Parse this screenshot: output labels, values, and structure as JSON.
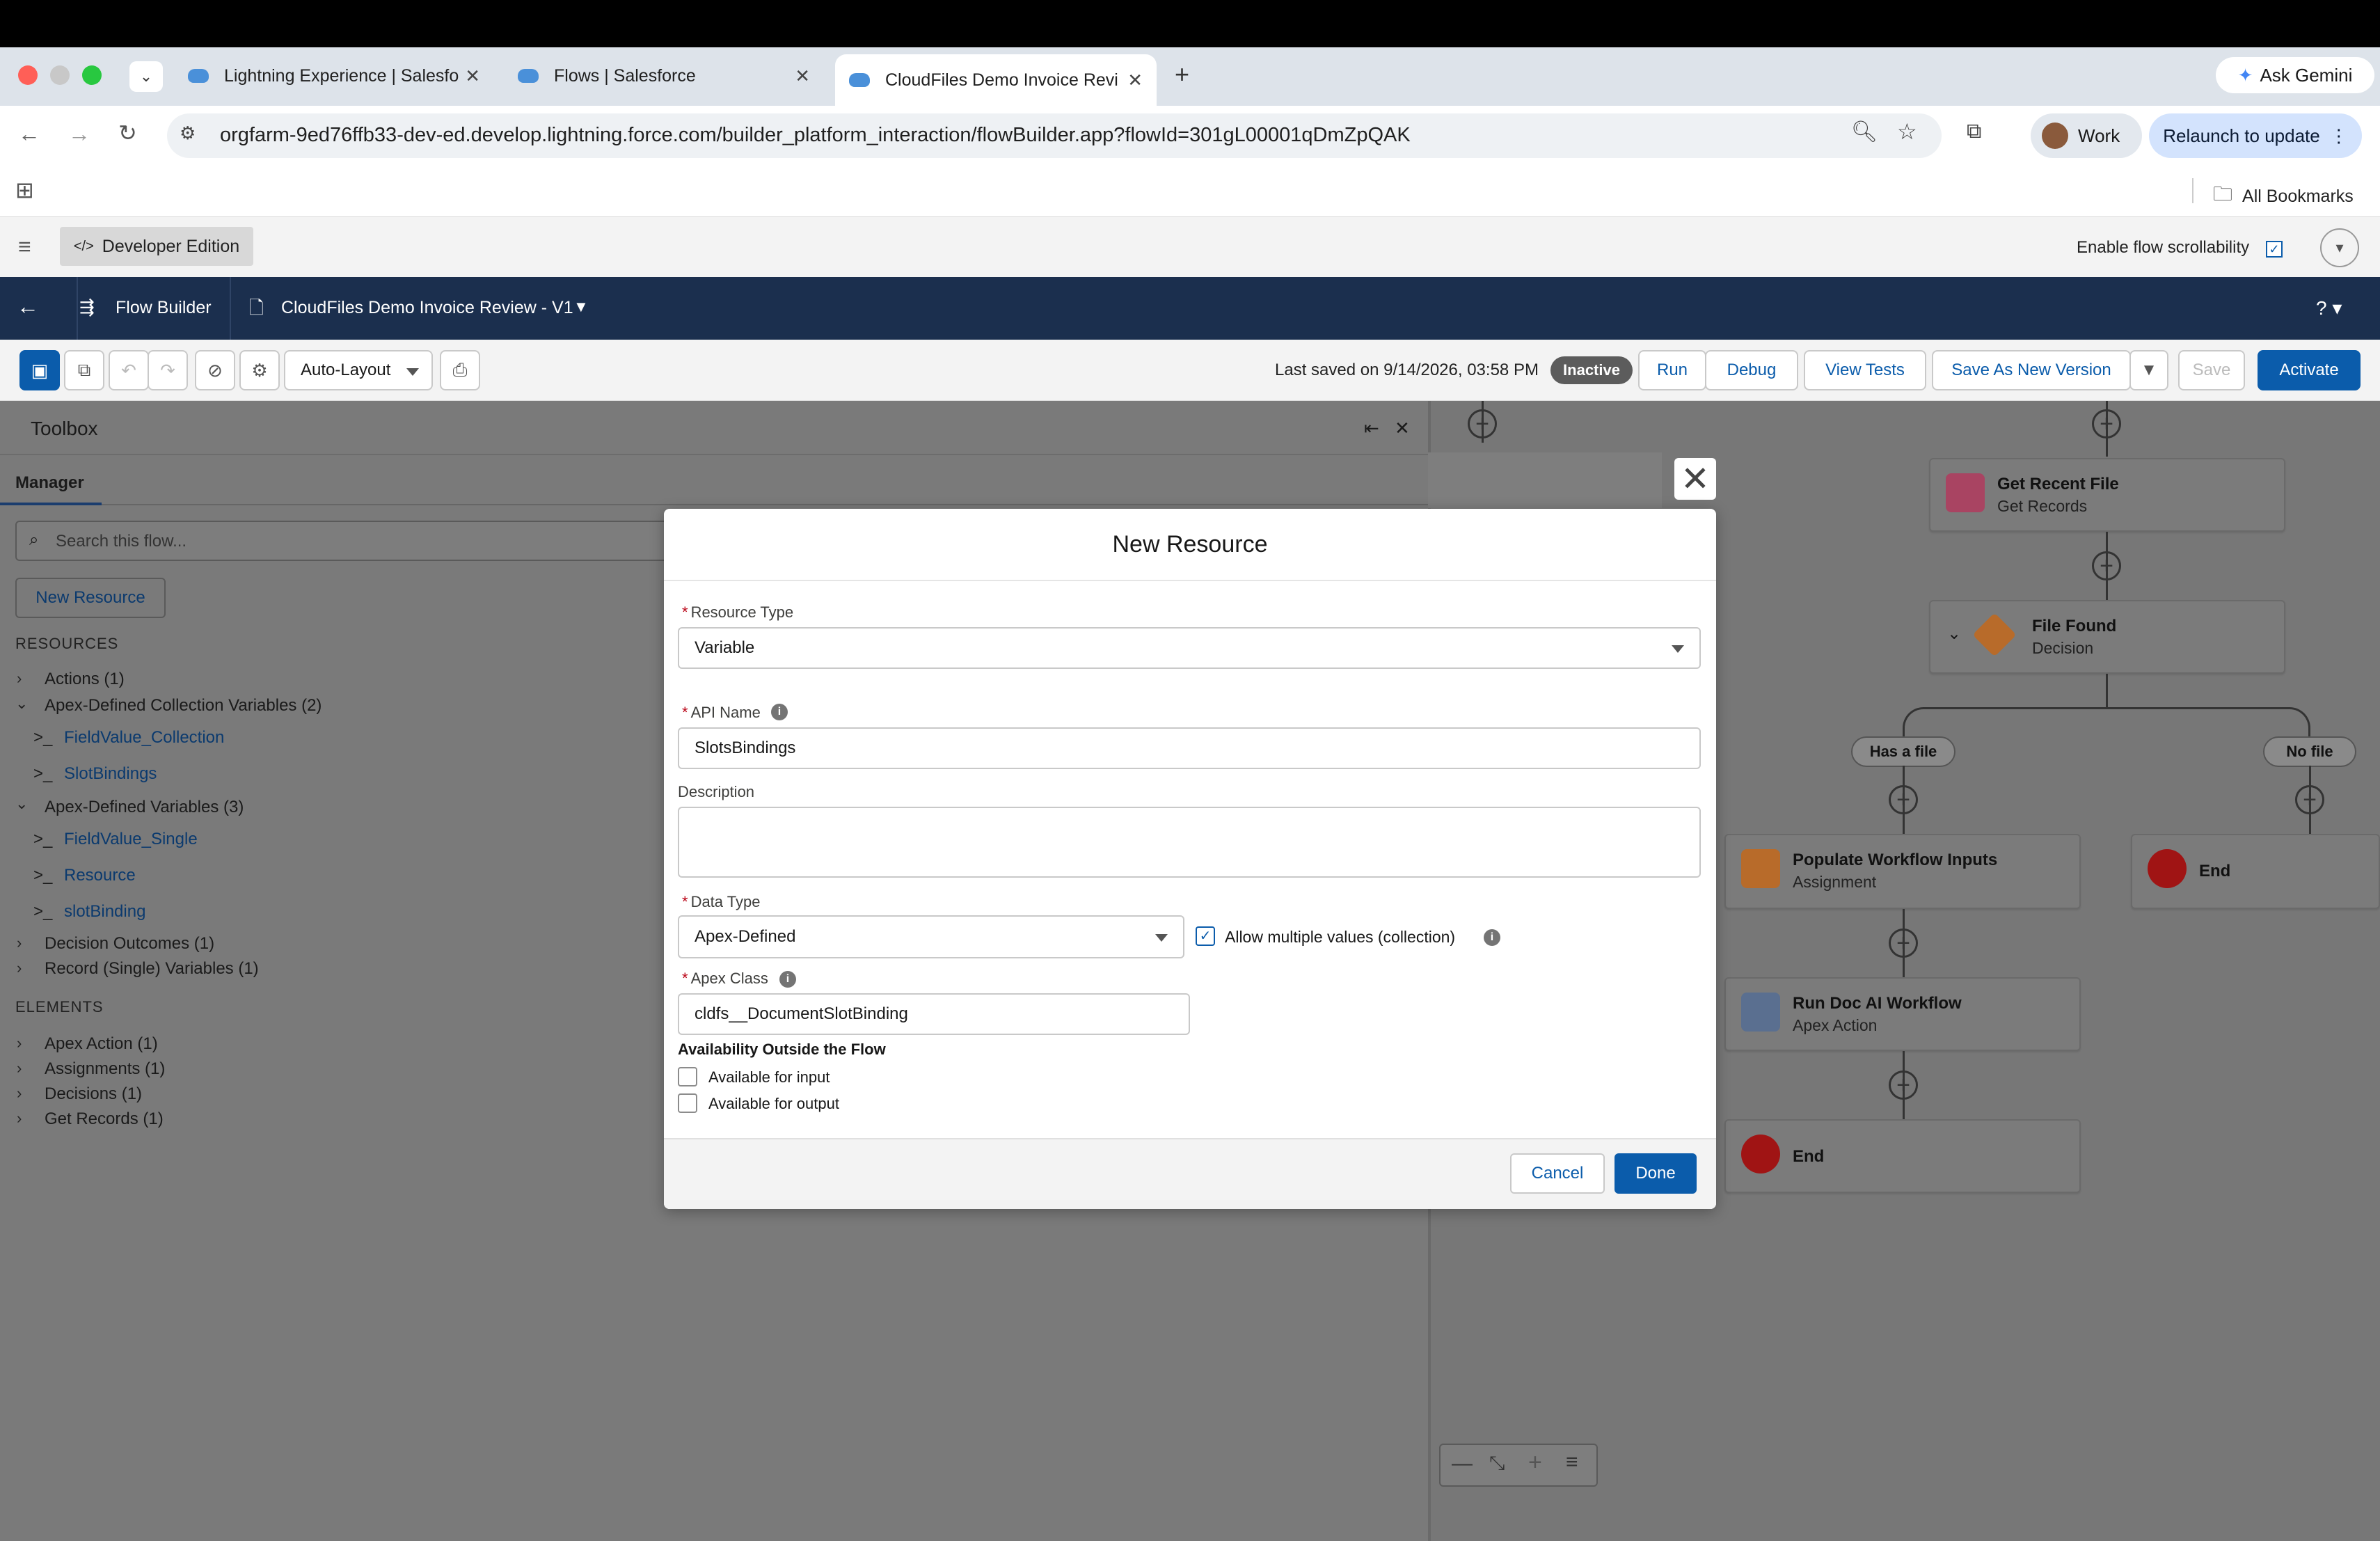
{
  "browser": {
    "tabs": [
      {
        "label": "Lightning Experience | Salesfo"
      },
      {
        "label": "Flows | Salesforce"
      },
      {
        "label": "CloudFiles Demo Invoice Revi"
      }
    ],
    "url": "orgfarm-9ed76ffb33-dev-ed.develop.lightning.force.com/builder_platform_interaction/flowBuilder.app?flowId=301gL00001qDmZpQAK",
    "ask_gemini": "Ask Gemini",
    "profile": "Work",
    "relaunch": "Relaunch to update",
    "bookmarks": "All Bookmarks"
  },
  "sf": {
    "app_label": "Developer Edition",
    "scroll_label": "Enable flow scrollability",
    "builder": "Flow Builder",
    "flow_name": "CloudFiles Demo Invoice Review - V1",
    "help": "?"
  },
  "toolbar": {
    "layout": "Auto-Layout",
    "last_saved": "Last saved on 9/14/2026, 03:58 PM",
    "status": "Inactive",
    "run": "Run",
    "debug": "Debug",
    "view_tests": "View Tests",
    "save_new": "Save As New Version",
    "save": "Save",
    "activate": "Activate"
  },
  "toolbox": {
    "title": "Toolbox",
    "tab": "Manager",
    "search_placeholder": "Search this flow...",
    "new_resource": "New Resource",
    "resources_heading": "RESOURCES",
    "elements_heading": "ELEMENTS",
    "resources": [
      {
        "label": "Actions (1)"
      },
      {
        "label": "Apex-Defined Collection Variables (2)"
      },
      {
        "label": "FieldValue_Collection"
      },
      {
        "label": "SlotBindings"
      },
      {
        "label": "Apex-Defined Variables (3)"
      },
      {
        "label": "FieldValue_Single"
      },
      {
        "label": "Resource"
      },
      {
        "label": "slotBinding"
      },
      {
        "label": "Decision Outcomes (1)"
      },
      {
        "label": "Record (Single) Variables (1)"
      }
    ],
    "elements": [
      {
        "label": "Apex Action (1)"
      },
      {
        "label": "Assignments (1)"
      },
      {
        "label": "Decisions (1)"
      },
      {
        "label": "Get Records (1)"
      }
    ]
  },
  "canvas": {
    "get_recent": {
      "title": "Get Recent File",
      "sub": "Get Records"
    },
    "file_found": {
      "title": "File Found",
      "sub": "Decision"
    },
    "has_file": "Has a file",
    "no_file": "No file",
    "populate": {
      "title": "Populate Workflow Inputs",
      "sub": "Assignment"
    },
    "run_doc": {
      "title": "Run Doc AI Workflow",
      "sub": "Apex Action"
    },
    "end1": "End",
    "end2": "End"
  },
  "modal": {
    "title": "New Resource",
    "resource_type_label": "Resource Type",
    "resource_type_value": "Variable",
    "api_name_label": "API Name",
    "api_name_value": "SlotsBindings",
    "description_label": "Description",
    "data_type_label": "Data Type",
    "data_type_value": "Apex-Defined",
    "allow_multiple": "Allow multiple values (collection)",
    "apex_class_label": "Apex Class",
    "apex_class_value": "cldfs__DocumentSlotBinding",
    "availability_heading": "Availability Outside the Flow",
    "avail_input": "Available for input",
    "avail_output": "Available for output",
    "cancel": "Cancel",
    "done": "Done"
  }
}
